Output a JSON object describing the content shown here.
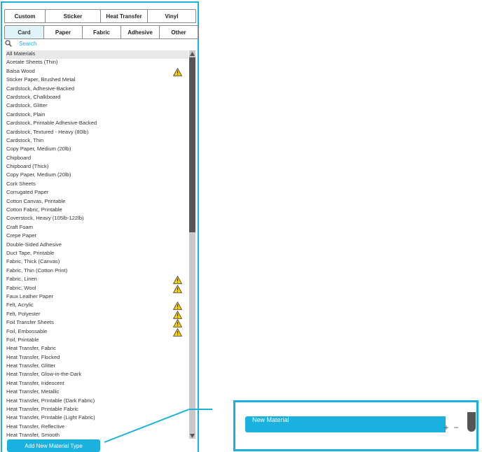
{
  "tabs_row1": [
    "Custom",
    "Sticker",
    "Heat Transfer",
    "Vinyl"
  ],
  "tabs_row2": [
    "Card",
    "Paper",
    "Fabric",
    "Adhesive",
    "Other"
  ],
  "search": {
    "placeholder": "Search"
  },
  "materials": [
    {
      "label": "All Materials",
      "selected": true
    },
    {
      "label": "Acetate Sheets (Thin)"
    },
    {
      "label": "Balsa Wood",
      "warning": true
    },
    {
      "label": "Sticker Paper, Brushed Metal"
    },
    {
      "label": "Cardstock, Adhesive-Backed"
    },
    {
      "label": "Cardstock, Chalkboard"
    },
    {
      "label": "Cardstock, Glitter"
    },
    {
      "label": "Cardstock, Plain"
    },
    {
      "label": "Cardstock, Printable Adhesive-Backed"
    },
    {
      "label": "Cardstock, Textured - Heavy (80lb)"
    },
    {
      "label": "Cardstock, Thin"
    },
    {
      "label": "Copy Paper, Medium (20lb)"
    },
    {
      "label": "Chipboard"
    },
    {
      "label": "Chipboard (Thick)"
    },
    {
      "label": "Copy Paper, Medium (20lb)"
    },
    {
      "label": "Cork Sheets"
    },
    {
      "label": "Corrugated Paper"
    },
    {
      "label": "Cotton Canvas, Printable"
    },
    {
      "label": "Cotton Fabric, Printable"
    },
    {
      "label": "Coverstock, Heavy (105lb-122lb)"
    },
    {
      "label": "Craft Foam"
    },
    {
      "label": "Crepe Paper"
    },
    {
      "label": "Double-Sided Adhesive"
    },
    {
      "label": "Duct Tape, Printable"
    },
    {
      "label": "Fabric, Thick (Canvas)"
    },
    {
      "label": "Fabric, Thin (Cotton Print)"
    },
    {
      "label": "Fabric, Linen",
      "warning": true
    },
    {
      "label": "Fabric, Wool",
      "warning": true
    },
    {
      "label": "Faux Leather Paper"
    },
    {
      "label": "Felt, Acrylic",
      "warning": true
    },
    {
      "label": "Felt, Polyester",
      "warning": true
    },
    {
      "label": "Foil Transfer Sheets",
      "warning": true
    },
    {
      "label": "Foil, Embossable",
      "warning": true
    },
    {
      "label": "Foil, Printable"
    },
    {
      "label": "Heat Transfer, Fabric"
    },
    {
      "label": "Heat Transfer, Flocked"
    },
    {
      "label": "Heat Transfer, Glitter"
    },
    {
      "label": "Heat Transfer, Glow-in-the-Dark"
    },
    {
      "label": "Heat Transfer, Iridescent"
    },
    {
      "label": "Heat Transfer, Metallic"
    },
    {
      "label": "Heat Transfer, Printable (Dark Fabric)"
    },
    {
      "label": "Heat Transfer, Printable Fabric"
    },
    {
      "label": "Heat Transfer, Printable (Light Fabric)"
    },
    {
      "label": "Heat Transfer, Reflective"
    },
    {
      "label": "Heat Transfer, Smooth"
    }
  ],
  "add_button_label": "Add New Material Type",
  "new_material": {
    "label": "New Material",
    "plus": "+",
    "minus": "−"
  },
  "colors": {
    "accent": "#1ab1de",
    "warning": "#f5d000",
    "scroll_thumb": "#565656"
  },
  "icons": {
    "search": "search-icon",
    "warning": "warning-icon"
  }
}
